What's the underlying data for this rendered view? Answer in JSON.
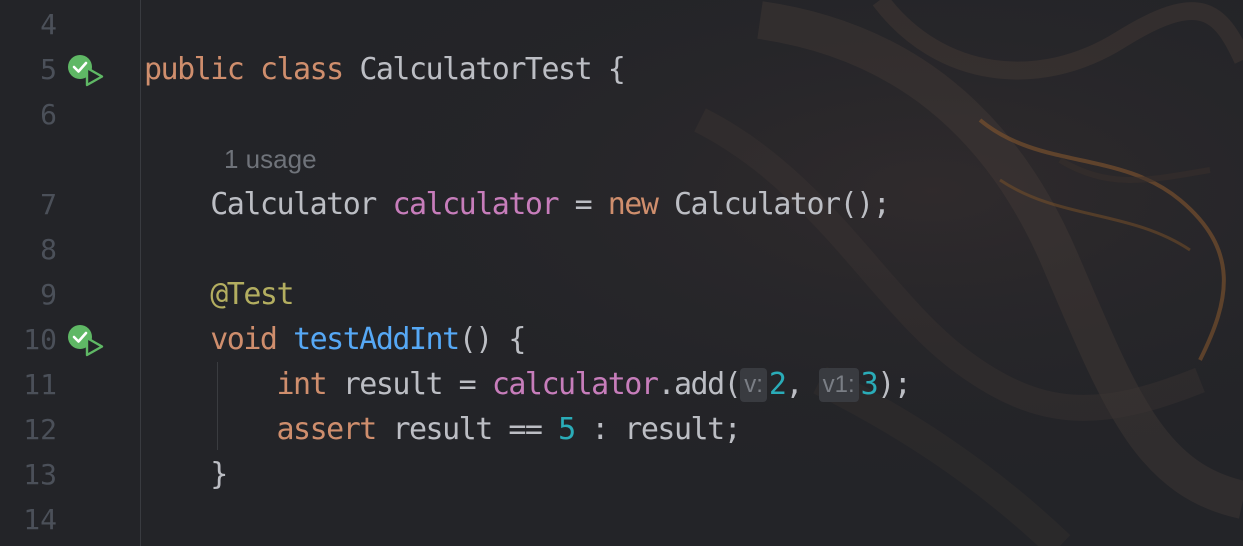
{
  "editor": {
    "lines": [
      {
        "num": "4"
      },
      {
        "num": "5"
      },
      {
        "num": "6"
      },
      {
        "num": ""
      },
      {
        "num": "7"
      },
      {
        "num": "8"
      },
      {
        "num": "9"
      },
      {
        "num": "10"
      },
      {
        "num": "11"
      },
      {
        "num": "12"
      },
      {
        "num": "13"
      },
      {
        "num": "14"
      }
    ],
    "code": {
      "l5_public": "public",
      "l5_class": "class",
      "l5_name": "CalculatorTest",
      "l5_brace": "{",
      "usage_hint": "1 usage",
      "l7_type": "Calculator",
      "l7_field": "calculator",
      "l7_eq": "=",
      "l7_new": "new",
      "l7_ctor": "Calculator();",
      "l9_ann": "@Test",
      "l10_void": "void",
      "l10_method": "testAddInt",
      "l10_rest": "() {",
      "l11_int": "int",
      "l11_mid": "result =",
      "l11_field": "calculator",
      "l11_call": ".add(",
      "l11_hint1": "v:",
      "l11_arg1": "2",
      "l11_comma": ",",
      "l11_hint2": "v1:",
      "l11_arg2": "3",
      "l11_end": ");",
      "l12_assert": "assert",
      "l12_mid": "result ==",
      "l12_num": "5",
      "l12_end": ": result;",
      "l13_brace": "}"
    },
    "run_icons": [
      {
        "line": "5",
        "icon": "run-test-passed-icon"
      },
      {
        "line": "10",
        "icon": "run-test-passed-icon"
      }
    ],
    "colors": {
      "background": "#232428",
      "keyword": "#cf8e6d",
      "field": "#c77dbb",
      "function": "#56a8f5",
      "annotation": "#b3ae60",
      "number": "#2aacb8",
      "text": "#bcbec4",
      "line_number": "#4b5059"
    }
  }
}
